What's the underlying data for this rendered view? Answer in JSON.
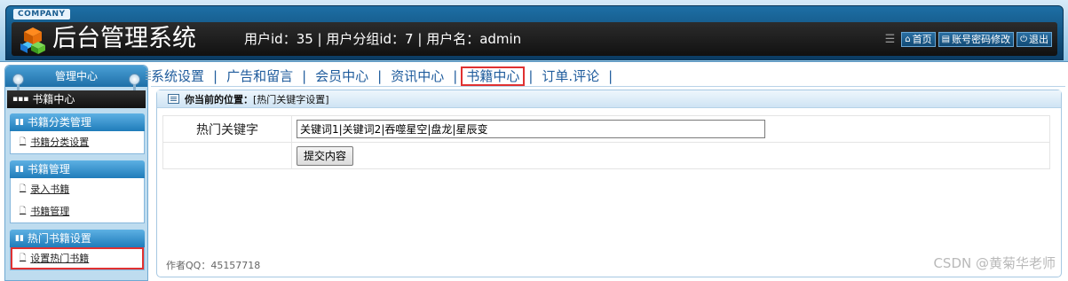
{
  "header": {
    "company": "COMPANY",
    "app_title": "后台管理系统",
    "user_info": "用户id：35 | 用户分组id：7 | 用户名：admin",
    "actions": [
      {
        "label": "首页",
        "icon": "home-icon"
      },
      {
        "label": "账号密码修改",
        "icon": "list-icon"
      },
      {
        "label": "退出",
        "icon": "power-icon"
      }
    ]
  },
  "sidebar": {
    "title": "管理中心",
    "module": "书籍中心",
    "groups": [
      {
        "title": "书籍分类管理",
        "items": [
          "书籍分类设置"
        ]
      },
      {
        "title": "书籍管理",
        "items": [
          "录入书籍",
          "书籍管理"
        ]
      },
      {
        "title": "热门书籍设置",
        "items": [
          "设置热门书籍"
        ]
      }
    ]
  },
  "menu": {
    "items": [
      "系统设置",
      "广告和留言",
      "会员中心",
      "资讯中心",
      "书籍中心",
      "订单.评论"
    ],
    "separator": "|",
    "active_index": 4
  },
  "content": {
    "breadcrumb_label": "你当前的位置：",
    "breadcrumb_value": "[热门关键字设置]",
    "form": {
      "field_label": "热门关键字",
      "field_value": "关键词1|关键词2|吞噬星空|盘龙|星辰变",
      "submit_label": "提交内容"
    },
    "author": "作者QQ：45157718"
  },
  "watermark": "CSDN @黄菊华老师",
  "colors": {
    "header_blue": "#1d6fa5",
    "title_bar_dark": "#111111",
    "highlight_red": "#e03131",
    "menu_text": "#1e5b9c"
  }
}
